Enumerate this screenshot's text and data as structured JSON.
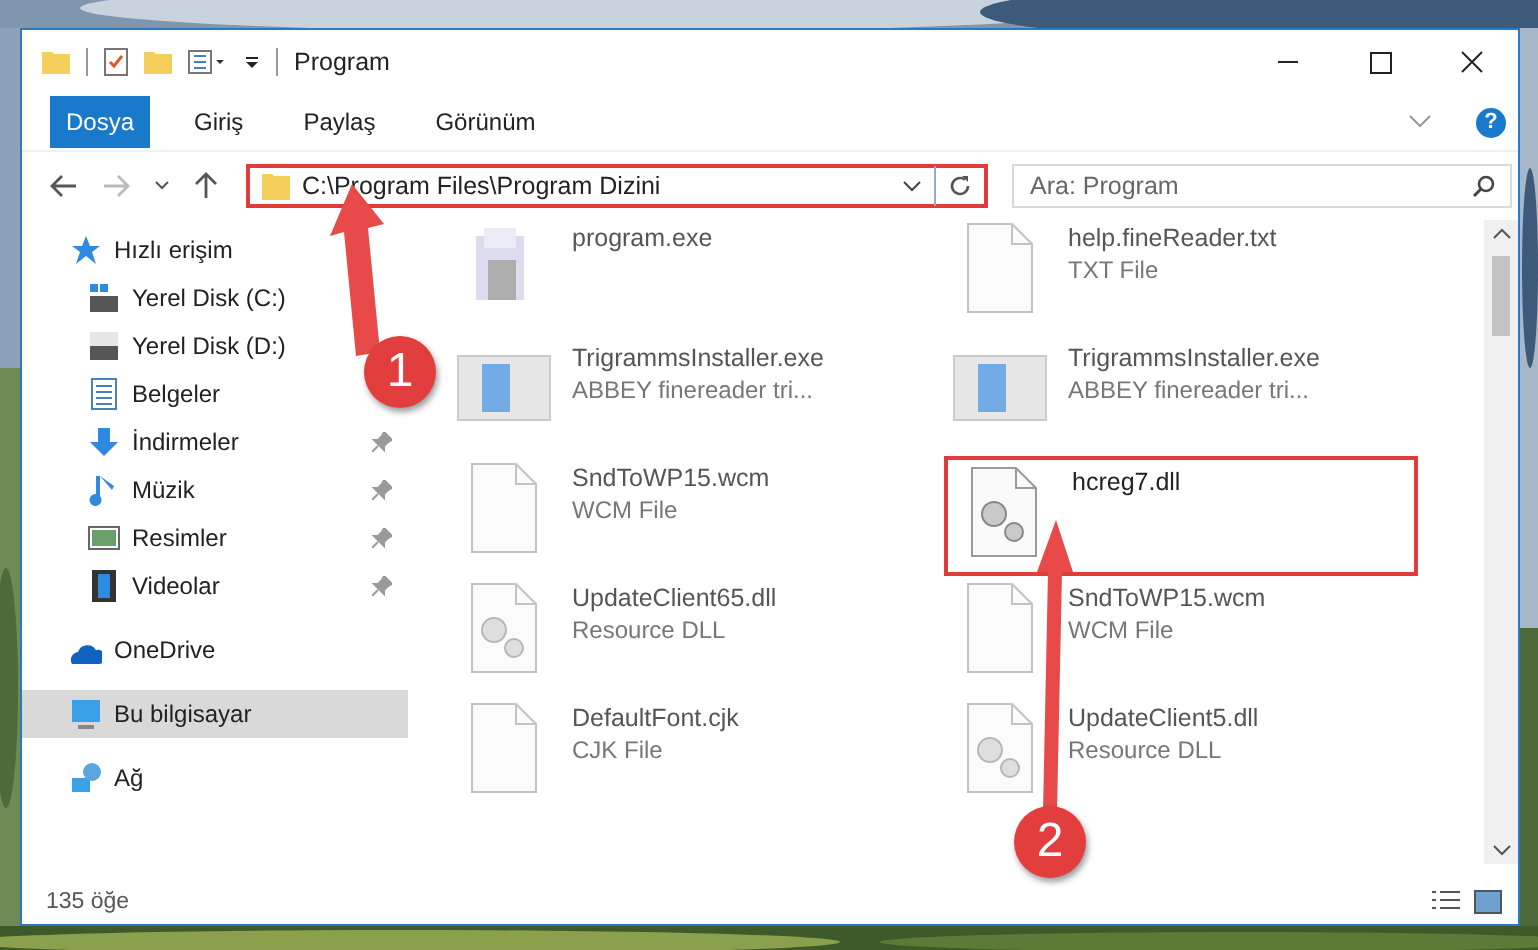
{
  "window": {
    "title": "Program"
  },
  "ribbon": {
    "tabs": [
      {
        "label": "Dosya",
        "selected": true
      },
      {
        "label": "Giriş",
        "selected": false
      },
      {
        "label": "Paylaş",
        "selected": false
      },
      {
        "label": "Görünüm",
        "selected": false
      }
    ],
    "help": "?"
  },
  "address": {
    "path": "C:\\Program Files\\Program Dizini",
    "highlighted": true
  },
  "search": {
    "placeholder": "Ara: Program"
  },
  "nav": [
    {
      "label": "Hızlı erişim",
      "kind": "star",
      "selected": false,
      "children": [
        {
          "label": "Yerel Disk (C:)",
          "kind": "drive-win",
          "pinned": false,
          "selected": false
        },
        {
          "label": "Yerel Disk (D:)",
          "kind": "drive",
          "pinned": false,
          "selected": false
        },
        {
          "label": "Belgeler",
          "kind": "docs",
          "pinned": false,
          "selected": false
        },
        {
          "label": "İndirmeler",
          "kind": "download",
          "pinned": true,
          "selected": false
        },
        {
          "label": "Müzik",
          "kind": "music",
          "pinned": true,
          "selected": false
        },
        {
          "label": "Resimler",
          "kind": "pictures",
          "pinned": true,
          "selected": false
        },
        {
          "label": "Videolar",
          "kind": "videos",
          "pinned": true,
          "selected": false
        }
      ]
    },
    {
      "label": "OneDrive",
      "kind": "cloud",
      "selected": false
    },
    {
      "label": "Bu bilgisayar",
      "kind": "pc",
      "selected": true
    },
    {
      "label": "Ağ",
      "kind": "network",
      "selected": false
    }
  ],
  "files": [
    {
      "name": "program.exe",
      "kind": "app",
      "blurred": true,
      "highlighted": false
    },
    {
      "name": "help.fineReader.txt",
      "type": "TXT File",
      "kind": "blank",
      "blurred": true,
      "highlighted": false
    },
    {
      "name": "TrigrammsInstaller.exe",
      "type": "ABBEY finereader tri...",
      "kind": "installer",
      "blurred": true,
      "highlighted": false
    },
    {
      "name": "TrigrammsInstaller.exe",
      "type": "ABBEY finereader tri...",
      "kind": "installer",
      "blurred": true,
      "highlighted": false
    },
    {
      "name": "SndToWP15.wcm",
      "type": "WCM File",
      "kind": "blank",
      "blurred": true,
      "highlighted": false
    },
    {
      "name": "hcreg7.dll",
      "kind": "dll",
      "blurred": false,
      "highlighted": true
    },
    {
      "name": "UpdateClient65.dll",
      "type": "Resource DLL",
      "kind": "dll",
      "blurred": true,
      "highlighted": false
    },
    {
      "name": "SndToWP15.wcm",
      "type": "WCM File",
      "kind": "blank",
      "blurred": true,
      "highlighted": false
    },
    {
      "name": "DefaultFont.cjk",
      "type": "CJK File",
      "kind": "blank",
      "blurred": true,
      "highlighted": false
    },
    {
      "name": "UpdateClient5.dll",
      "type": "Resource DLL",
      "kind": "dll",
      "blurred": true,
      "highlighted": false
    }
  ],
  "status_bar": {
    "count": "135 öğe"
  },
  "annotations": [
    {
      "label": "1"
    },
    {
      "label": "2"
    }
  ]
}
